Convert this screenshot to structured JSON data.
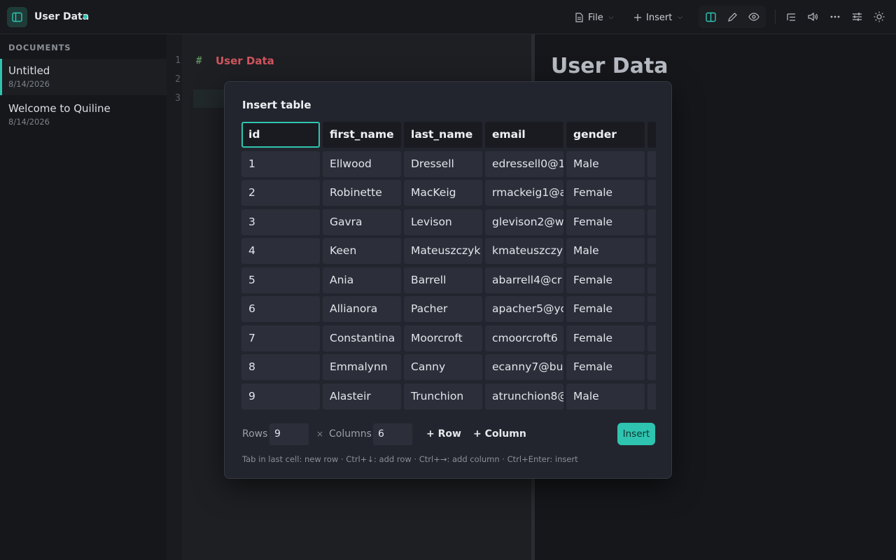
{
  "app": {
    "document_title": "User Data",
    "menus": {
      "file": "File",
      "insert": "Insert"
    }
  },
  "icons": {
    "sidebar_toggle": "sidebar-toggle-icon",
    "file": "file-icon",
    "insert": "plus-icon",
    "split_view": "split-view-icon",
    "edit": "pencil-icon",
    "preview": "eye-icon",
    "outline": "outline-icon",
    "read_aloud": "speaker-icon",
    "more": "more-icon",
    "settings": "sliders-icon",
    "theme": "sun-icon"
  },
  "sidebar": {
    "heading": "DOCUMENTS",
    "documents": [
      {
        "name": "Untitled",
        "date": "8/14/2026"
      },
      {
        "name": "Welcome to Quiline",
        "date": "8/14/2026"
      }
    ]
  },
  "editor": {
    "line_numbers": [
      "1",
      "2",
      "3"
    ],
    "heading_marker": "#",
    "heading_text": "User Data"
  },
  "preview": {
    "heading": "User Data"
  },
  "modal": {
    "title": "Insert table",
    "headers": [
      "id",
      "first_name",
      "last_name",
      "email",
      "gender"
    ],
    "rows": [
      [
        "1",
        "Ellwood",
        "Dressell",
        "edressell0@1",
        "Male"
      ],
      [
        "2",
        "Robinette",
        "MacKeig",
        "rmackeig1@a",
        "Female"
      ],
      [
        "3",
        "Gavra",
        "Levison",
        "glevison2@w",
        "Female"
      ],
      [
        "4",
        "Keen",
        "Mateuszczyk",
        "kmateuszczy",
        "Male"
      ],
      [
        "5",
        "Ania",
        "Barrell",
        "abarrell4@cr",
        "Female"
      ],
      [
        "6",
        "Allianora",
        "Pacher",
        "apacher5@yo",
        "Female"
      ],
      [
        "7",
        "Constantina",
        "Moorcroft",
        "cmoorcroft6",
        "Female"
      ],
      [
        "8",
        "Emmalynn",
        "Canny",
        "ecanny7@bu",
        "Female"
      ],
      [
        "9",
        "Alasteir",
        "Trunchion",
        "atrunchion8@",
        "Male"
      ]
    ],
    "rows_label": "Rows",
    "rows_value": "9",
    "times": "×",
    "columns_label": "Columns",
    "columns_value": "6",
    "add_row": "+ Row",
    "add_column": "+ Column",
    "insert": "Insert",
    "hint": "Tab in last cell: new row · Ctrl+↓: add row · Ctrl+→: add column · Ctrl+Enter: insert"
  },
  "colors": {
    "accent": "#2ec4b0",
    "heading_red": "#d0565e",
    "background": "#16171b",
    "modal": "#23252e"
  }
}
